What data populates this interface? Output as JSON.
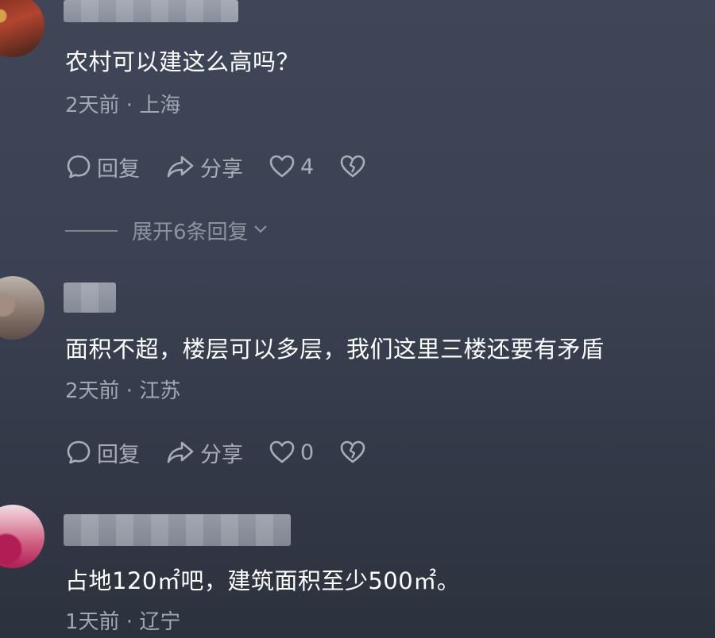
{
  "comments": [
    {
      "text": "农村可以建这么高吗？",
      "meta": "2天前 · 上海",
      "reply_label": "回复",
      "share_label": "分享",
      "likes": "4",
      "expand_label": "展开6条回复"
    },
    {
      "text": "面积不超，楼层可以多层，我们这里三楼还要有矛盾",
      "meta": "2天前 · 江苏",
      "reply_label": "回复",
      "share_label": "分享",
      "likes": "0"
    },
    {
      "text": "占地120㎡吧，建筑面积至少500㎡。",
      "meta": "1天前 · 辽宁"
    }
  ],
  "icons": {
    "reply": "comment-bubble-icon",
    "share": "share-arrow-icon",
    "like": "heart-icon",
    "dislike": "broken-heart-icon",
    "expand": "chevron-down-icon"
  },
  "colors": {
    "text": "#ffffff",
    "meta": "#a2a8b3",
    "action": "#a8adb7"
  }
}
